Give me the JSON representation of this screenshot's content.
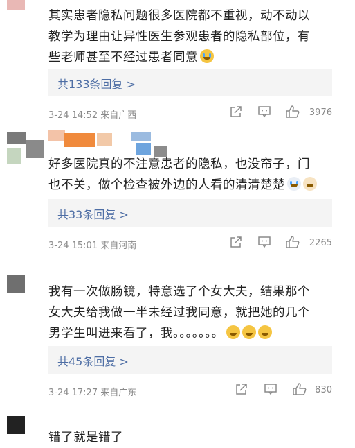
{
  "comments": [
    {
      "text": "其实患者隐私问题很多医院都不重视，动不动以教学为理由让异性医生参观患者的隐私部位，有些老师甚至不经过患者同意",
      "lines": [
        "其实患者隐私问题很多医院都不重视，动不动以",
        "教学为理由让异性医生参观患者的隐私部位，有",
        "些老师甚至不经过患者同意"
      ],
      "replies": "共133条回复 >",
      "time": "3-24 14:52 来自广西",
      "likes": "3976"
    },
    {
      "text": "好多医院真的不注意患者的隐私，也没帘子，门也不关，做个检查被外边的人看的清清楚楚",
      "lines": [
        "好多医院真的不注意患者的隐私，也没帘子，门",
        "也不关，做个检查被外边的人看的清清楚楚"
      ],
      "replies": "共33条回复 >",
      "time": "3-24 15:01 来自河南",
      "likes": "2265"
    },
    {
      "text": "我有一次做肠镜，特意选了个女大夫，结果那个女大夫给我做一半未经过我同意，就把她的几个男学生叫进来看了，我。。。。。。。",
      "lines": [
        "我有一次做肠镜，特意选了个女大夫，结果那个",
        "女大夫给我做一半未经过我同意，就把她的几个",
        "男学生叫进来看了，我。。。。。。。"
      ],
      "replies": "共45条回复 >",
      "time": "3-24 17:27 来自广东",
      "likes": "830"
    },
    {
      "text": "错了就是错了",
      "lines": [
        "错了就是错了"
      ]
    }
  ],
  "icons": [
    "share-icon",
    "comment-icon",
    "like-icon",
    "cry-emoji",
    "laugh-cry-emoji"
  ],
  "colors": {
    "link": "#4e6ea5",
    "meta": "#8a8a8a",
    "reply_bg": "#f4f4f4",
    "text": "#222222"
  }
}
